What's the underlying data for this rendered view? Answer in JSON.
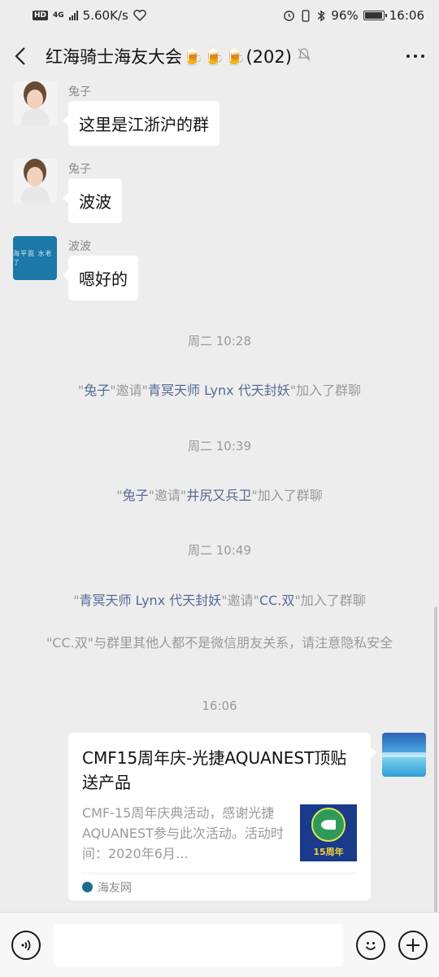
{
  "status_bar": {
    "hd": "HD",
    "network": "4G",
    "speed": "5.60K/s",
    "battery_percent": "96%",
    "battery_level": 0.96,
    "time": "16:06"
  },
  "header": {
    "back_icon": "chevron-left-icon",
    "title": "红海骑士海友大会🍺🍺🍺(202)",
    "mute_icon": "bell-off-icon",
    "more_icon": "more-dots-icon"
  },
  "messages": [
    {
      "sender": "兔子",
      "text": "这里是江浙沪的群",
      "avatar": "girl"
    },
    {
      "sender": "兔子",
      "text": "波波",
      "avatar": "girl"
    },
    {
      "sender": "波波",
      "text": "嗯好的",
      "avatar": "blue-logo"
    }
  ],
  "avatar_blue_text": "海平面 水老了",
  "system": {
    "time1": "周二 10:28",
    "invite1": {
      "a": "兔子",
      "verb": "邀请",
      "b": "青冥天师 Lynx 代天封妖",
      "suffix": "加入了群聊"
    },
    "time2": "周二 10:39",
    "invite2": {
      "a": "兔子",
      "verb": "邀请",
      "b": "井尻又兵卫",
      "suffix": "加入了群聊"
    },
    "time3": "周二 10:49",
    "invite3": {
      "a": "青冥天师 Lynx 代天封妖",
      "verb": "邀请",
      "b": "CC.双",
      "suffix": "加入了群聊"
    },
    "warning": "\"CC.双\"与群里其他人都不是微信朋友关系，请注意隐私安全",
    "time4": "16:06"
  },
  "card": {
    "title": "CMF15周年庆-光捷AQUANEST顶贴送产品",
    "desc": "CMF-15周年庆典活动，感谢光捷AQUANEST参与此次活动。活动时间：2020年6月…",
    "thumb_text": "15周年",
    "source": "海友网"
  },
  "input_bar": {
    "voice_icon": "voice-icon",
    "emoji_icon": "emoji-icon",
    "plus_icon": "plus-icon"
  }
}
